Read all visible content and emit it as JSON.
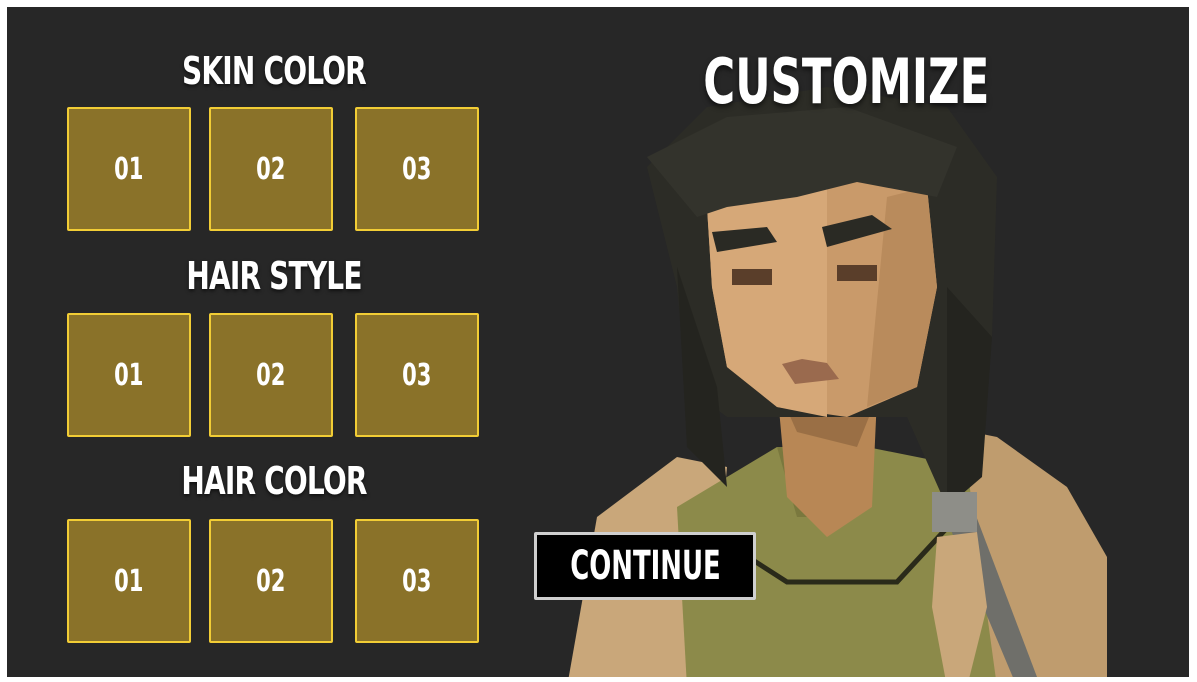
{
  "title": "CUSTOMIZE",
  "sections": [
    {
      "label": "SKIN COLOR",
      "options": [
        "01",
        "02",
        "03"
      ]
    },
    {
      "label": "HAIR STYLE",
      "options": [
        "01",
        "02",
        "03"
      ]
    },
    {
      "label": "HAIR COLOR",
      "options": [
        "01",
        "02",
        "03"
      ]
    }
  ],
  "continue_label": "CONTINUE",
  "colors": {
    "background": "#272727",
    "option_fill": "#8a7229",
    "option_border": "#f2cd35",
    "button_fill": "#000000",
    "button_border": "#cfcfcf",
    "text": "#ffffff"
  },
  "character": {
    "skin_color": "#c99a6a",
    "hair_color": "#2c2c26",
    "shirt_color": "#8c8a4a",
    "jacket_color": "#c9a77a"
  }
}
